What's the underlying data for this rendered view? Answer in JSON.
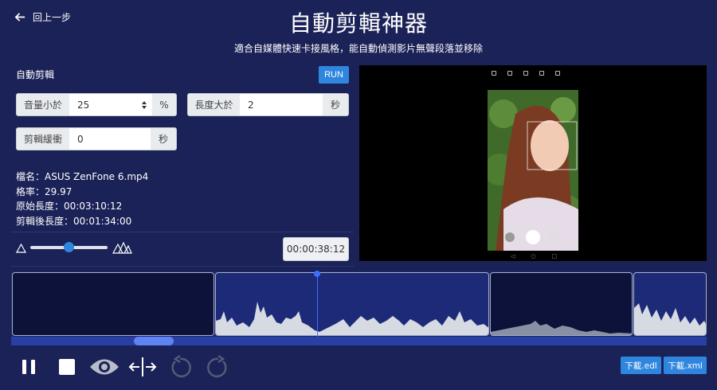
{
  "header": {
    "back_label": "回上一步",
    "title": "自動剪輯神器",
    "subtitle": "適合自媒體快速卡接風格，能自動偵測影片無聲段落並移除"
  },
  "auto_cut": {
    "section_label": "自動剪輯",
    "run_label": "RUN",
    "volume": {
      "label": "音量小於",
      "value": "25",
      "unit": "%"
    },
    "length": {
      "label": "長度大於",
      "value": "2",
      "unit": "秒"
    },
    "buffer": {
      "label": "剪輯緩衝",
      "value": "0",
      "unit": "秒"
    }
  },
  "file_info": {
    "filename": "檔名：ASUS ZenFone 6.mp4",
    "framerate": "格率：29.97",
    "original_length": "原始長度：00:03:10:12",
    "edited_length": "剪輯後長度：00:01:34:00"
  },
  "sensitivity": {
    "level": 0.5
  },
  "timecode": "00:00:38:12",
  "timeline": {
    "scroll_fraction": 0.2,
    "playhead_fraction": 0.44
  },
  "controls": {
    "pause_icon": "pause-icon",
    "stop_icon": "stop-icon",
    "preview_icon": "eye-icon",
    "split_icon": "split-arrows-icon",
    "undo_icon": "undo-icon",
    "redo_icon": "redo-icon"
  },
  "downloads": {
    "edl_label": "下載.edl",
    "xml_label": "下載.xml"
  },
  "colors": {
    "background": "#1b2257",
    "accent": "#2f86de",
    "timeline": "#1c2870",
    "playhead": "#3b6dff"
  }
}
